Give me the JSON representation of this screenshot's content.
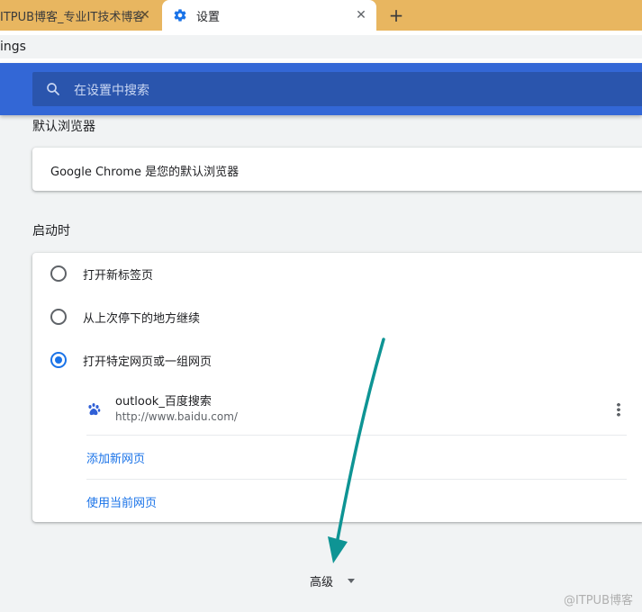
{
  "tabs": [
    {
      "title": "ITPUB博客_专业IT技术博客",
      "close": "✕"
    },
    {
      "title": "设置",
      "close": "✕",
      "icon": "gear-icon"
    }
  ],
  "new_tab": "+",
  "address_bar": {
    "url_fragment": "ings"
  },
  "search": {
    "placeholder": "在设置中搜索",
    "icon": "search-icon"
  },
  "default_browser": {
    "title": "默认浏览器",
    "status": "Google Chrome 是您的默认浏览器"
  },
  "startup": {
    "title": "启动时",
    "options": [
      {
        "label": "打开新标签页",
        "checked": false
      },
      {
        "label": "从上次停下的地方继续",
        "checked": false
      },
      {
        "label": "打开特定网页或一组网页",
        "checked": true
      }
    ],
    "pages": [
      {
        "name": "outlook_百度搜索",
        "url": "http://www.baidu.com/",
        "icon": "baidu-paw-icon"
      }
    ],
    "add_page": "添加新网页",
    "use_current": "使用当前网页"
  },
  "advanced": {
    "label": "高级"
  },
  "watermark": "@ITPUB博客",
  "colors": {
    "tabstrip": "#e8b660",
    "header": "#3367d6",
    "search_box": "#2a55ad",
    "accent": "#1a73e8",
    "annotation_arrow": "#0e9494"
  }
}
